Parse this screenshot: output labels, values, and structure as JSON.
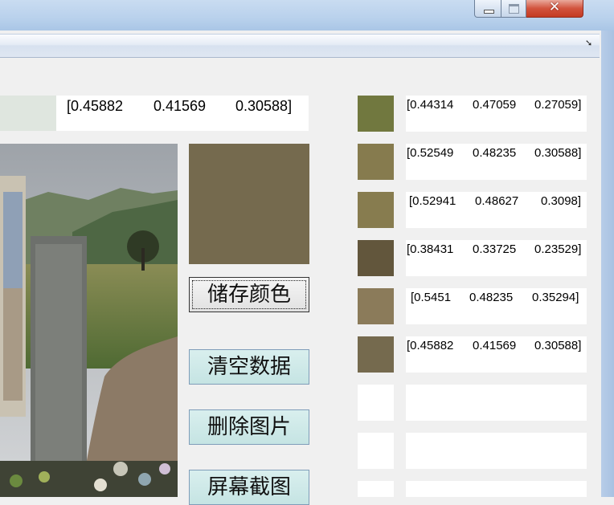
{
  "current": {
    "swatch_color": "#dfe6df",
    "v1": "[0.45882",
    "v2": "0.41569",
    "v3": "0.30588]"
  },
  "preview": {
    "color": "#756a4e"
  },
  "buttons": {
    "save": "储存颜色",
    "clear": "清空数据",
    "delete_image": "删除图片",
    "screenshot": "屏幕截图"
  },
  "swatches": [
    {
      "color": "#71783f",
      "v1": "[0.44314",
      "v2": "0.47059",
      "v3": "0.27059]"
    },
    {
      "color": "#867b4e",
      "v1": "[0.52549",
      "v2": "0.48235",
      "v3": "0.30588]"
    },
    {
      "color": "#877c4f",
      "v1": "[0.52941",
      "v2": "0.48627",
      "v3": "0.3098]"
    },
    {
      "color": "#62563c",
      "v1": "[0.38431",
      "v2": "0.33725",
      "v3": "0.23529]"
    },
    {
      "color": "#8b7b5a",
      "v1": "[0.5451",
      "v2": "0.48235",
      "v3": "0.35294]"
    },
    {
      "color": "#756a4e",
      "v1": "[0.45882",
      "v2": "0.41569",
      "v3": "0.30588]"
    },
    {
      "color": "#ffffff",
      "v1": "",
      "v2": "",
      "v3": ""
    },
    {
      "color": "#ffffff",
      "v1": "",
      "v2": "",
      "v3": ""
    },
    {
      "color": "#ffffff",
      "v1": "",
      "v2": "",
      "v3": ""
    }
  ]
}
